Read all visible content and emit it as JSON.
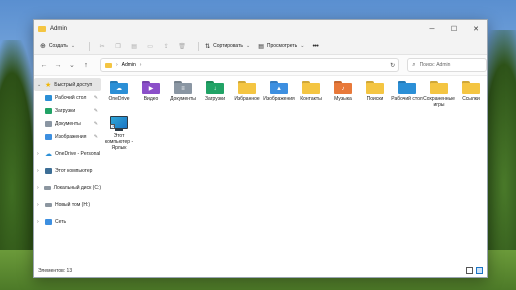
{
  "window": {
    "title": "Admin"
  },
  "window_controls": {
    "minimize": "─",
    "maximize": "☐",
    "close": "✕"
  },
  "commandbar": {
    "new_label": "Создать",
    "sort_label": "Сортировать",
    "view_label": "Просмотреть",
    "more_label": "•••",
    "icons": [
      "cut-icon",
      "copy-icon",
      "paste-icon",
      "rename-icon",
      "share-icon",
      "delete-icon"
    ]
  },
  "address": {
    "back": "←",
    "forward": "→",
    "recent": "⌄",
    "up": "↑",
    "path": "Admin",
    "chevron": "›",
    "search_placeholder": "Поиск: Admin"
  },
  "sidebar": {
    "quick_access": "Быстрый доступ",
    "pinned": [
      {
        "label": "Рабочий стол",
        "color": "#2b8fd6"
      },
      {
        "label": "Загрузки",
        "color": "#21a366"
      },
      {
        "label": "Документы",
        "color": "#8a96a3"
      },
      {
        "label": "Изображения",
        "color": "#3d8fe0"
      }
    ],
    "onedrive": "OneDrive - Personal",
    "this_pc": "Этот компьютер",
    "local_disk": "Локальный диск (C:)",
    "new_volume": "Новый том (H:)",
    "network": "Сеть"
  },
  "items": [
    {
      "label": "OneDrive",
      "color": "#2b8fd6",
      "glyph": "☁"
    },
    {
      "label": "Видео",
      "color": "#8b4fc9",
      "glyph": "▶"
    },
    {
      "label": "Документы",
      "color": "#8a96a3",
      "glyph": "≡"
    },
    {
      "label": "Загрузки",
      "color": "#21a366",
      "glyph": "↓"
    },
    {
      "label": "Избранное",
      "color": "#f4c542",
      "glyph": ""
    },
    {
      "label": "Изображения",
      "color": "#3d8fe0",
      "glyph": "▲"
    },
    {
      "label": "Контакты",
      "color": "#f4c542",
      "glyph": ""
    },
    {
      "label": "Музыка",
      "color": "#e8793a",
      "glyph": "♪"
    },
    {
      "label": "Поиски",
      "color": "#f4c542",
      "glyph": ""
    },
    {
      "label": "Рабочий стол",
      "color": "#2b8fd6",
      "glyph": ""
    },
    {
      "label": "Сохраненные игры",
      "color": "#f4c542",
      "glyph": ""
    },
    {
      "label": "Ссылки",
      "color": "#f4c542",
      "glyph": ""
    }
  ],
  "shortcut": {
    "label": "Этот компьютер - Ярлык",
    "arrow": "↗"
  },
  "status": {
    "count": "Элементов: 13"
  }
}
